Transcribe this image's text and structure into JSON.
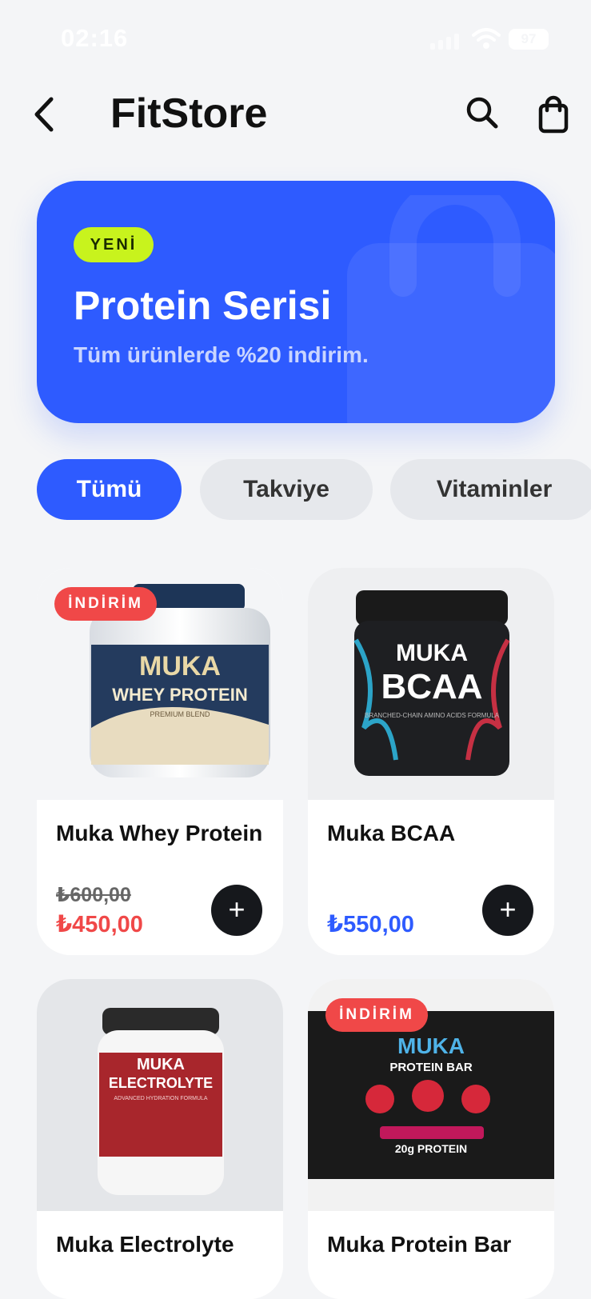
{
  "status": {
    "time": "02:16",
    "battery": "97"
  },
  "header": {
    "title": "FitStore",
    "back_icon": "chevron-left-icon",
    "search_icon": "search-icon",
    "cart_icon": "shopping-bag-icon"
  },
  "banner": {
    "badge": "YENİ",
    "title": "Protein Serisi",
    "subtitle": "Tüm ürünlerde %20 indirim.",
    "color": "#2E5BFF"
  },
  "categories": [
    {
      "label": "Tümü",
      "active": true
    },
    {
      "label": "Takviye",
      "active": false
    },
    {
      "label": "Vitaminler",
      "active": false
    }
  ],
  "products": [
    {
      "name": "Muka Whey Protein",
      "badge": "İNDİRİM",
      "old_price": "₺600,00",
      "price": "₺450,00",
      "brand": "MUKA",
      "line1": "WHEY PROTEIN",
      "line2": "PREMIUM BLEND",
      "add_label": "+"
    },
    {
      "name": "Muka BCAA",
      "badge": "",
      "old_price": "",
      "price": "₺550,00",
      "brand": "MUKA",
      "line1": "BCAA",
      "line2": "BRANCHED-CHAIN AMINO ACIDS FORMULA",
      "add_label": "+"
    },
    {
      "name": "Muka Electrolyte",
      "badge": "",
      "brand": "MUKA",
      "line1": "ELECTROLYTE",
      "line2": "ADVANCED HYDRATION FORMULA"
    },
    {
      "name": "Muka Protein Bar",
      "badge": "İNDİRİM",
      "brand": "MUKA",
      "line1": "PROTEIN BAR",
      "line2": "20g PROTEIN"
    }
  ],
  "colors": {
    "accent": "#2E5BFF",
    "sale": "#F04848",
    "new_badge": "#C8F31D"
  }
}
